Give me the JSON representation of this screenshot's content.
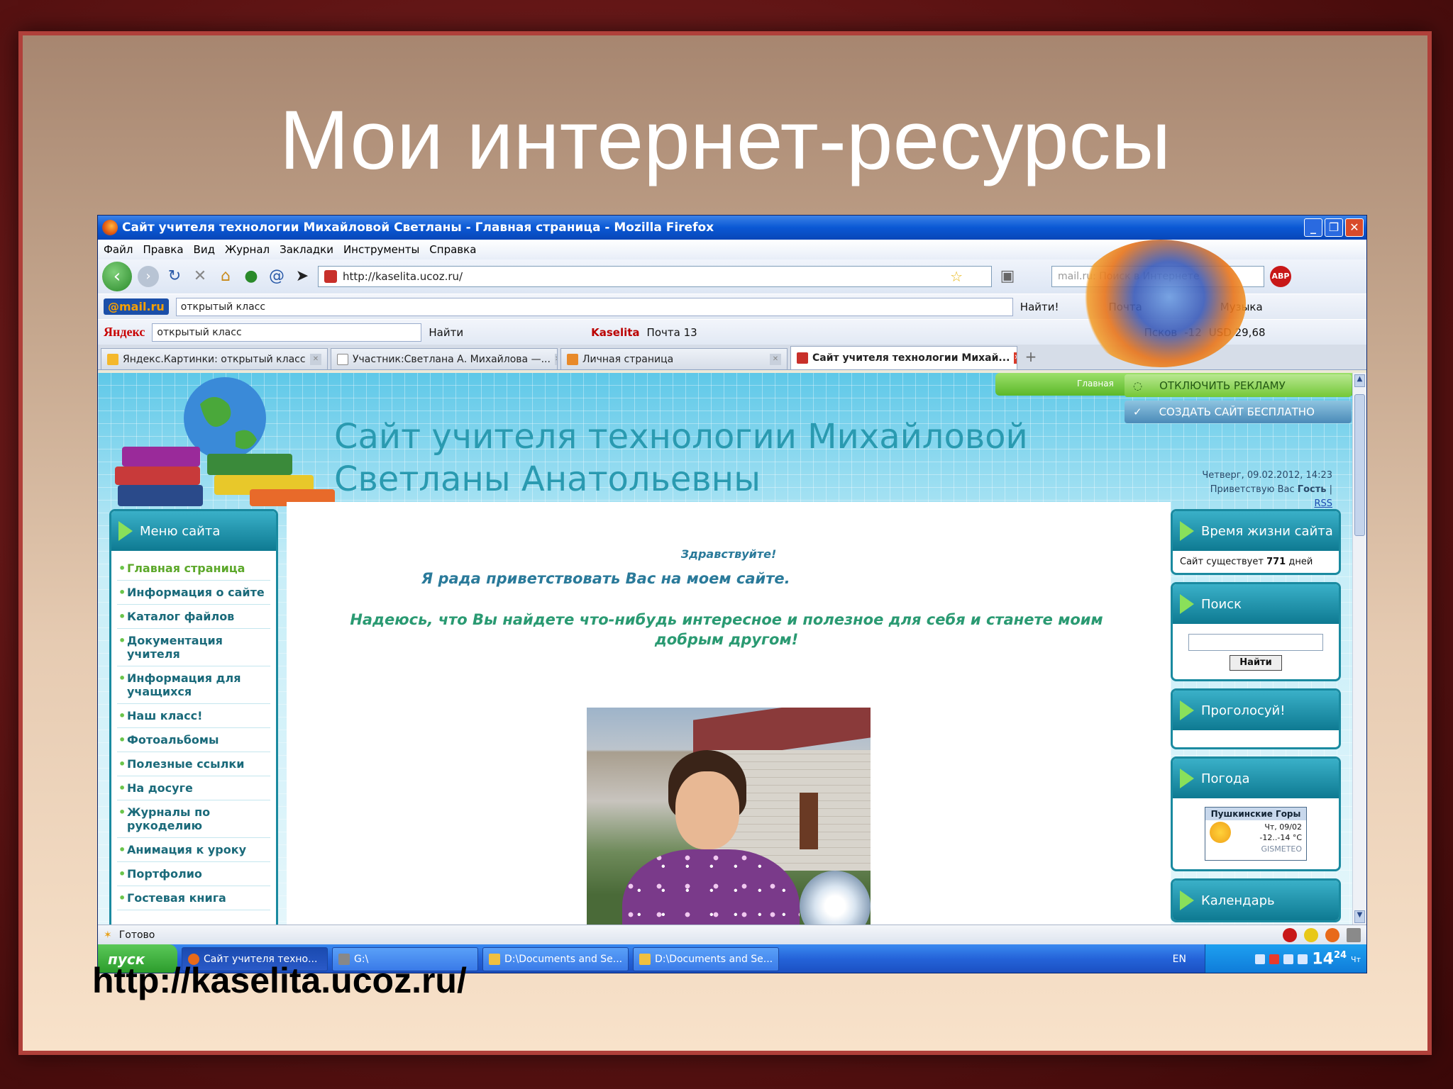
{
  "slide": {
    "title": "Мои интернет-ресурсы",
    "caption": "http://kaselita.ucoz.ru/"
  },
  "window": {
    "title": "Сайт учителя технологии Михайловой Светланы - Главная страница - Mozilla Firefox",
    "controls": {
      "minimize": "_",
      "maximize": "❐",
      "close": "✕"
    }
  },
  "menu": [
    "Файл",
    "Правка",
    "Вид",
    "Журнал",
    "Закладки",
    "Инструменты",
    "Справка"
  ],
  "navbar": {
    "url": "http://kaselita.ucoz.ru/",
    "search_placeholder": "mail.ru: Поиск в Интернете",
    "abp": "ABP"
  },
  "mailru_bar": {
    "logo": "@mail.ru",
    "query": "открытый класс",
    "find": "Найти!",
    "pochta": "Почта",
    "music": "Музыка"
  },
  "yandex_bar": {
    "logo": "Яндекс",
    "query": "открытый класс",
    "find": "Найти",
    "user": "Kaselita",
    "mail": "Почта 13",
    "city": "Псков",
    "temp": "-12",
    "usd": "USD 29,68"
  },
  "tabs": [
    {
      "label": "Яндекс.Картинки: открытый класс",
      "active": false
    },
    {
      "label": "Участник:Светлана А. Михайлова —...",
      "active": false
    },
    {
      "label": "Личная страница",
      "active": false
    },
    {
      "label": "Сайт учителя технологии Михай...",
      "active": true
    }
  ],
  "site": {
    "title": "Сайт учителя технологии Михайловой Светланы Анатольевны",
    "green_label": "Главная",
    "ad_off": "ОТКЛЮЧИТЬ РЕКЛАМУ",
    "ad_create": "СОЗДАТЬ САЙТ БЕСПЛАТНО",
    "date": "Четверг, 09.02.2012, 14:23",
    "greeting_prefix": "Приветствую Вас",
    "guest": "Гость",
    "rss": "RSS"
  },
  "left_menu": {
    "header": "Меню сайта",
    "items": [
      "Главная страница",
      "Информация о сайте",
      "Каталог файлов",
      "Документация учителя",
      "Информация для учащихся",
      "Наш класс!",
      "Фотоальбомы",
      "Полезные ссылки",
      "На досуге",
      "Журналы по рукоделию",
      "Анимация к уроку",
      "Портфолио",
      "Гостевая книга"
    ]
  },
  "main": {
    "hello": "Здравствуйте!",
    "glad": "Я рада приветствовать Вас на моем сайте.",
    "hope": "Надеюсь, что Вы найдете что-нибудь интересное и полезное для себя и станете моим добрым другом!"
  },
  "right_col": {
    "lifetime_header": "Время жизни сайта",
    "lifetime_prefix": "Сайт существует",
    "lifetime_days": "771",
    "lifetime_suffix": "дней",
    "search_header": "Поиск",
    "search_button": "Найти",
    "vote_header": "Проголосуй!",
    "weather_header": "Погода",
    "weather_city": "Пушкинские Горы",
    "weather_date": "Чт, 09/02",
    "weather_temp": "-12..-14 °C",
    "weather_brand": "GISMETEO",
    "calendar_header": "Календарь"
  },
  "statusbar": {
    "text": "Готово"
  },
  "taskbar": {
    "start": "пуск",
    "tasks": [
      {
        "label": "Сайт учителя техно...",
        "active": true
      },
      {
        "label": "G:\\",
        "active": false
      },
      {
        "label": "D:\\Documents and Se...",
        "active": false
      },
      {
        "label": "D:\\Documents and Se...",
        "active": false
      }
    ],
    "lang": "EN",
    "clock_h": "14",
    "clock_m": "24",
    "clock_day": "Чт"
  }
}
